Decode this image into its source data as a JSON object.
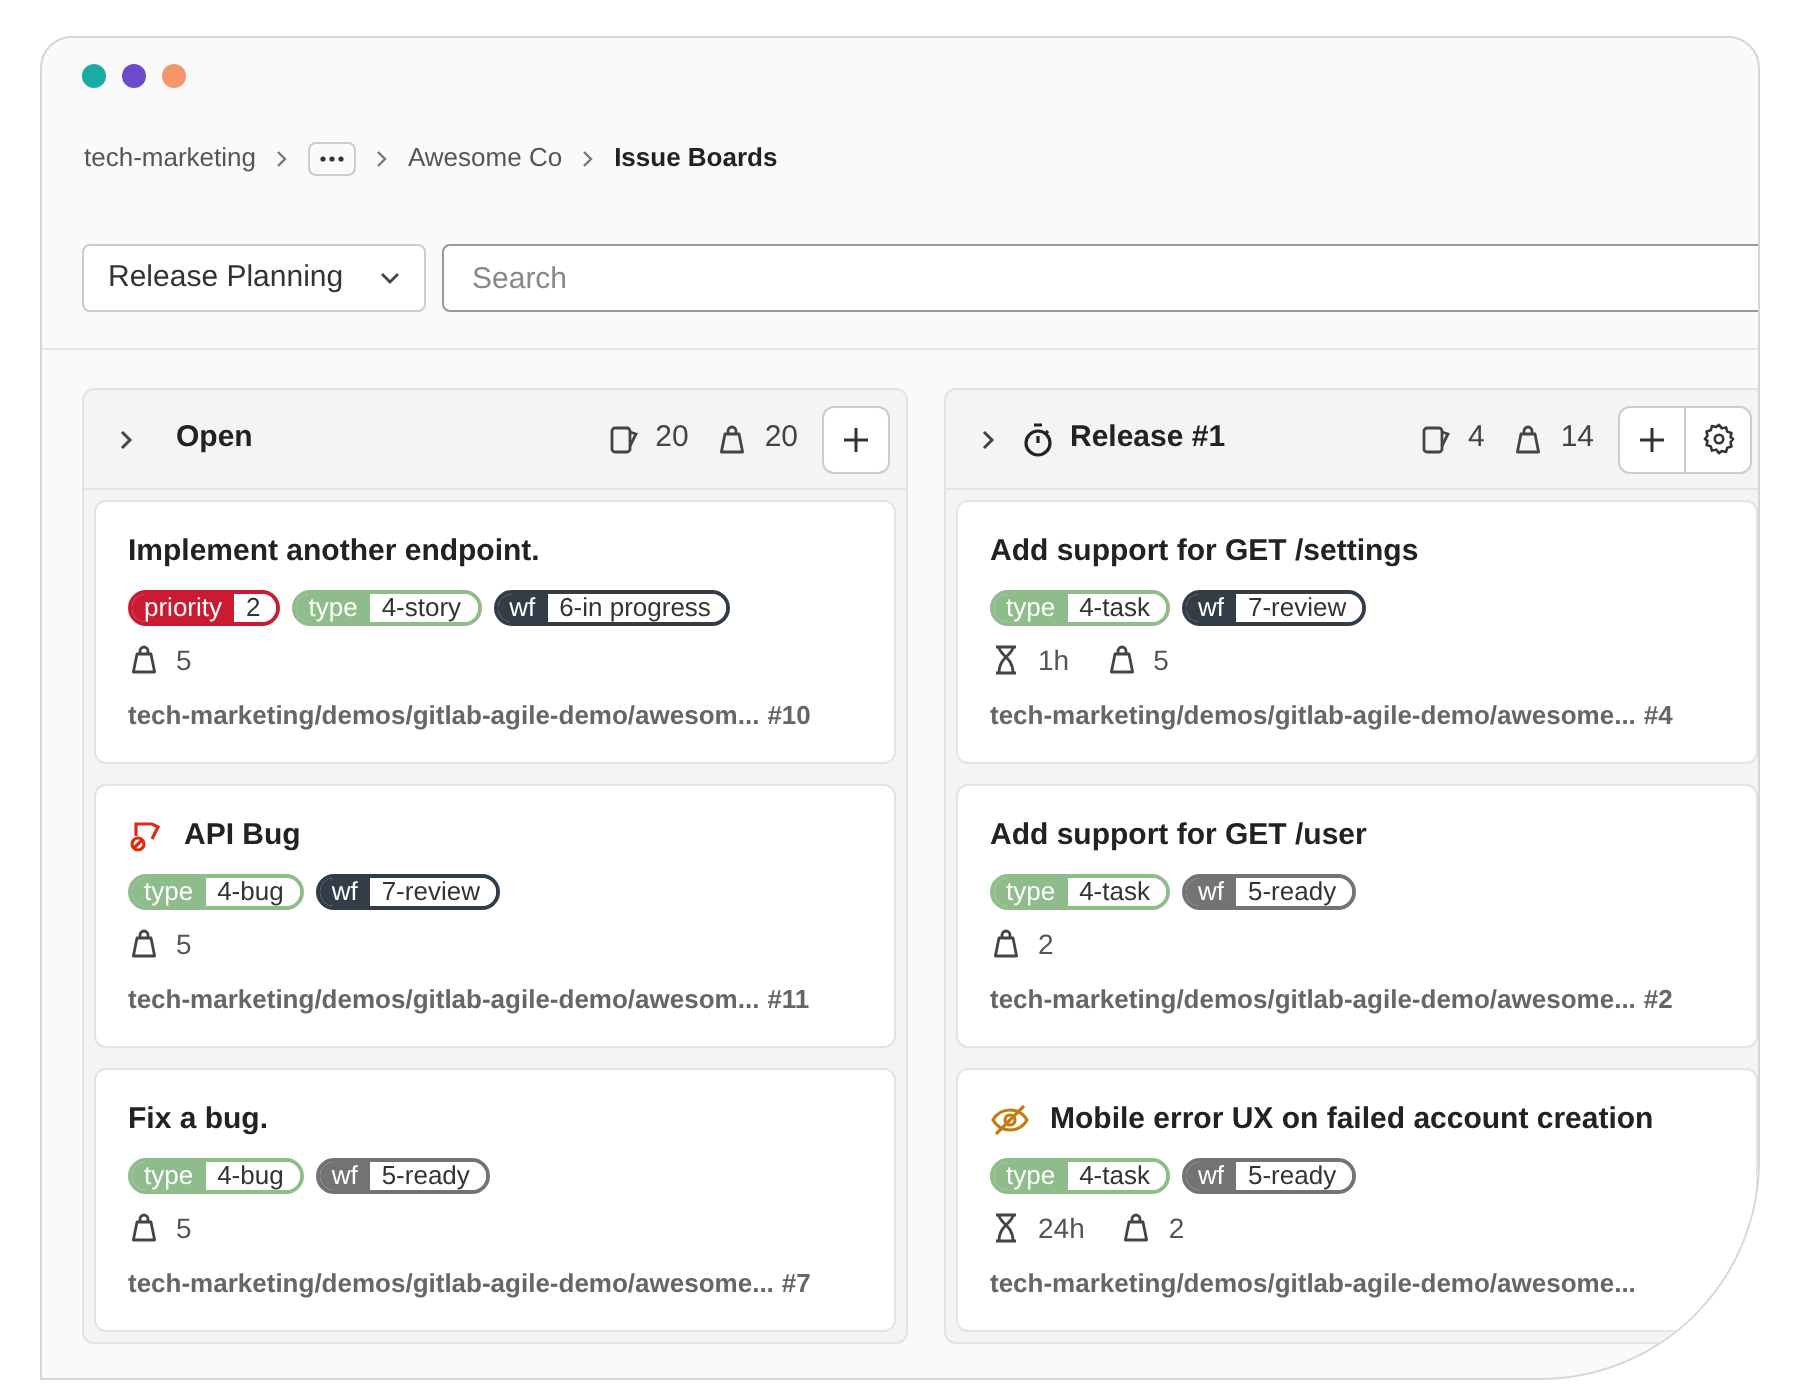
{
  "window": {
    "controls": [
      {
        "color": "#1aaba5"
      },
      {
        "color": "#6e49cb"
      },
      {
        "color": "#f4956b"
      }
    ]
  },
  "breadcrumb": [
    {
      "kind": "link",
      "text": "tech-marketing"
    },
    {
      "kind": "more"
    },
    {
      "kind": "link",
      "text": "Awesome Co"
    },
    {
      "kind": "current",
      "text": "Issue Boards"
    }
  ],
  "board_selector": {
    "value": "Release Planning"
  },
  "search": {
    "placeholder": "Search"
  },
  "lists": [
    {
      "title": "Open",
      "kind": "open",
      "issue_count": "20",
      "weight": "20",
      "settings": false,
      "cards": [
        {
          "kind": "issue",
          "title": "Implement another endpoint.",
          "labels": [
            {
              "key": "priority",
              "value": "2",
              "color": "#c91c32"
            },
            {
              "key": "type",
              "value": "4-story",
              "color": "#8fbc8b"
            },
            {
              "key": "wf",
              "value": "6-in progress",
              "color": "#333d47"
            }
          ],
          "weight": "5",
          "path": "tech-marketing/demos/gitlab-agile-demo/awesom...",
          "ref": "#10"
        },
        {
          "kind": "incident",
          "title": "API Bug",
          "labels": [
            {
              "key": "type",
              "value": "4-bug",
              "color": "#8fbc8b"
            },
            {
              "key": "wf",
              "value": "7-review",
              "color": "#333d47"
            }
          ],
          "weight": "5",
          "path": "tech-marketing/demos/gitlab-agile-demo/awesom...",
          "ref": "#11"
        },
        {
          "kind": "issue",
          "title": "Fix a bug.",
          "labels": [
            {
              "key": "type",
              "value": "4-bug",
              "color": "#8fbc8b"
            },
            {
              "key": "wf",
              "value": "5-ready",
              "color": "#737373"
            }
          ],
          "weight": "5",
          "path": "tech-marketing/demos/gitlab-agile-demo/awesome...",
          "ref": "#7"
        }
      ]
    },
    {
      "title": "Release #1",
      "kind": "milestone",
      "issue_count": "4",
      "weight": "14",
      "settings": true,
      "cards": [
        {
          "kind": "issue",
          "title": "Add support for GET /settings",
          "labels": [
            {
              "key": "type",
              "value": "4-task",
              "color": "#8fbc8b"
            },
            {
              "key": "wf",
              "value": "7-review",
              "color": "#333d47"
            }
          ],
          "time_estimate": "1h",
          "weight": "5",
          "path": "tech-marketing/demos/gitlab-agile-demo/awesome...",
          "ref": "#4"
        },
        {
          "kind": "issue",
          "title": "Add support for GET /user",
          "labels": [
            {
              "key": "type",
              "value": "4-task",
              "color": "#8fbc8b"
            },
            {
              "key": "wf",
              "value": "5-ready",
              "color": "#737373"
            }
          ],
          "weight": "2",
          "path": "tech-marketing/demos/gitlab-agile-demo/awesome...",
          "ref": "#2"
        },
        {
          "kind": "confidential",
          "title": "Mobile error UX on failed account creation",
          "labels": [
            {
              "key": "type",
              "value": "4-task",
              "color": "#8fbc8b"
            },
            {
              "key": "wf",
              "value": "5-ready",
              "color": "#737373"
            }
          ],
          "time_estimate": "24h",
          "weight": "2",
          "path": "tech-marketing/demos/gitlab-agile-demo/awesome..."
        }
      ]
    }
  ]
}
